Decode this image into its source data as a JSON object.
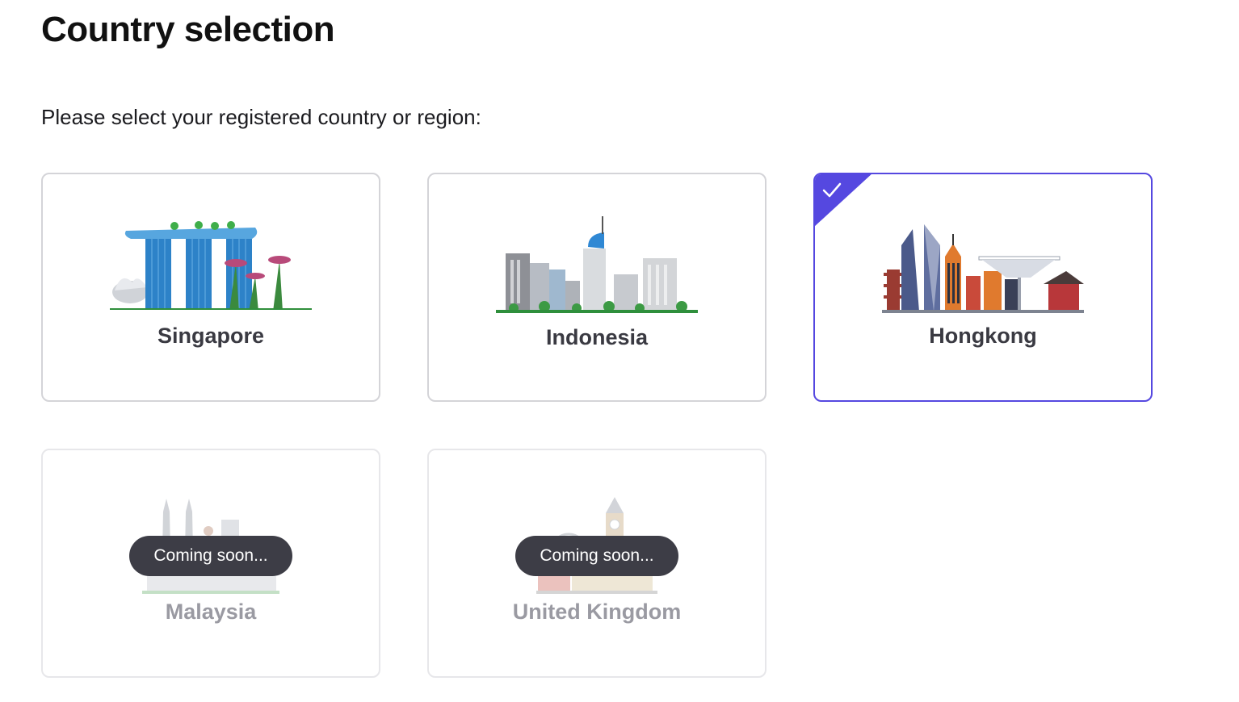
{
  "header": {
    "title": "Country selection"
  },
  "instruction": "Please select your registered country or region:",
  "countries": [
    {
      "name": "Singapore",
      "illustration": "singapore-skyline",
      "status": "available"
    },
    {
      "name": "Indonesia",
      "illustration": "jakarta-skyline",
      "status": "available"
    },
    {
      "name": "Hongkong",
      "illustration": "hongkong-skyline",
      "status": "selected"
    },
    {
      "name": "Malaysia",
      "illustration": "kuala-lumpur-skyline",
      "status": "coming-soon",
      "badge": "Coming soon..."
    },
    {
      "name": "United Kingdom",
      "illustration": "london-skyline",
      "status": "coming-soon",
      "badge": "Coming soon..."
    }
  ],
  "selected_check_icon": "check-icon",
  "colors": {
    "accent": "#5548e0",
    "pill": "#3d3d46",
    "border": "#d4d4d8",
    "muted_text": "#9a9aa2"
  }
}
